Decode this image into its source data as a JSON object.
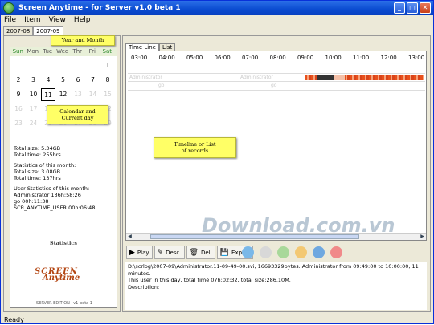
{
  "window": {
    "title": "Screen Anytime - for Server  v1.0 beta 1"
  },
  "menu": [
    "File",
    "Item",
    "View",
    "Help"
  ],
  "year_tabs": [
    "2007-08",
    "2007-09"
  ],
  "callouts": {
    "year_month": "Year and Month",
    "calendar_line1": "Calendar and",
    "calendar_line2": "Current day",
    "timeline_line1": "Timeline or List",
    "timeline_line2": "of records"
  },
  "calendar": {
    "days": [
      "Sun",
      "Mon",
      "Tue",
      "Wed",
      "Thr",
      "Fri",
      "Sat"
    ],
    "weeks": [
      [
        "",
        "",
        "",
        "",
        "",
        "",
        "1"
      ],
      [
        "2",
        "3",
        "4",
        "5",
        "6",
        "7",
        "8"
      ],
      [
        "9",
        "10",
        "11",
        "12",
        "13",
        "14",
        "15"
      ],
      [
        "16",
        "17",
        "18",
        "19",
        "20",
        "21",
        "22"
      ],
      [
        "23",
        "24",
        "25",
        "26",
        "27",
        "28",
        "29"
      ]
    ],
    "current_day": "11",
    "dim_days": [
      "13",
      "14",
      "15",
      "16",
      "17",
      "18",
      "19",
      "20",
      "21",
      "22",
      "23",
      "24",
      "25",
      "26",
      "27",
      "28",
      "29"
    ]
  },
  "stats": {
    "total_size": "Total size: 5.34GB",
    "total_time": "Total time: 255hrs",
    "month_heading": "Statistics of this month:",
    "month_size": "Total size: 3.08GB",
    "month_time": "Total time: 137hrs",
    "user_heading": "User Statistics of this month:",
    "user1": "Administrator 136h:58:26",
    "user2": "go 00h:11:38",
    "user3": "SCR_ANYTIME_USER 00h:06:48",
    "label": "Statistics",
    "logo_line1": "SCREEN",
    "logo_line2": "Anytime",
    "edition": "SERVER EDITION",
    "version": "v1 beta 1"
  },
  "view_tabs": [
    "Time Line",
    "List"
  ],
  "timeline": {
    "hours": [
      "03:00",
      "04:00",
      "05:00",
      "06:00",
      "07:00",
      "08:00",
      "09:00",
      "10:00",
      "11:00",
      "12:00",
      "13:00"
    ],
    "ghost_labels": [
      "Administrator",
      "Administrator",
      "go",
      "go"
    ]
  },
  "toolbar": {
    "play": "Play",
    "desc": "Desc.",
    "del": "Del.",
    "export": "Export"
  },
  "color_dots": [
    "#7ab8e8",
    "#d8d8d8",
    "#a8d89a",
    "#f3c873",
    "#6fa8e0",
    "#f08a8a"
  ],
  "watermark": "Download.com.vn",
  "details": {
    "line1": "D:\\scrlog\\2007-09\\Administrator.11-09-49-00.svi, 16693329bytes. Administrator from 09:49:00 to 10:00:00, 11 minutes.",
    "line2": "This user in this day, total time 07h:02:32, total size:286.10M.",
    "line3": "Description:"
  },
  "status": "Ready"
}
